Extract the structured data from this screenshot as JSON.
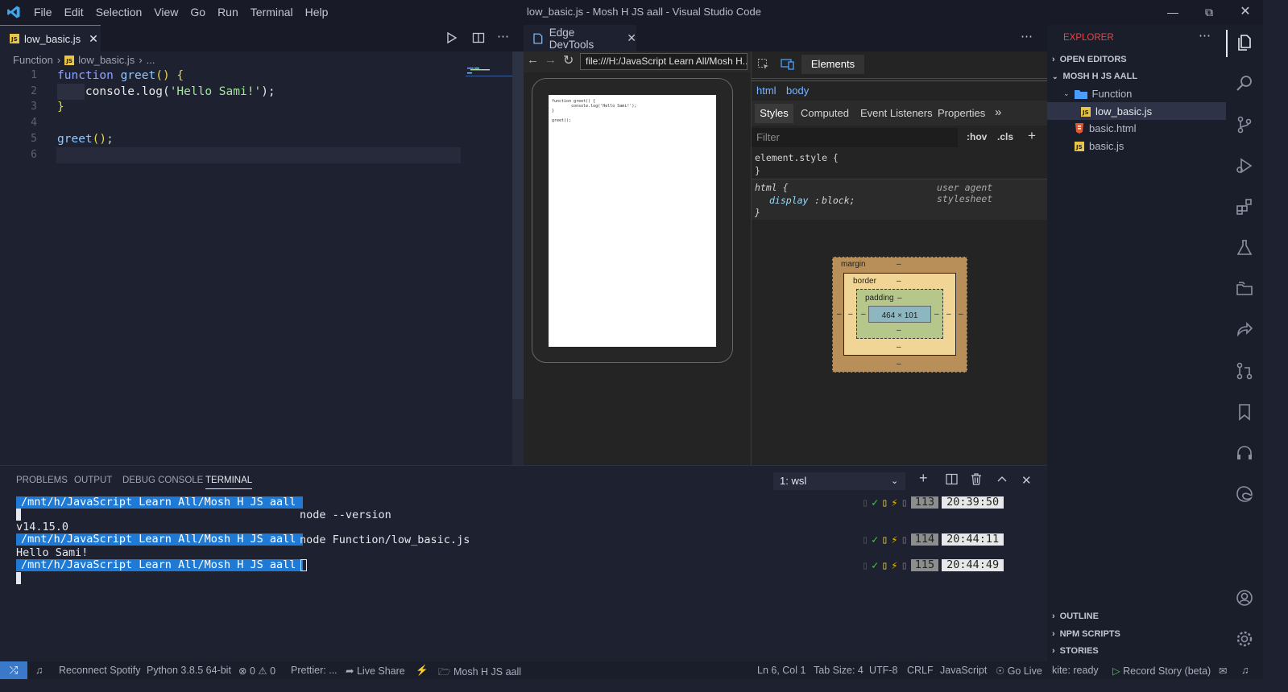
{
  "window": {
    "title": "low_basic.js - Mosh H JS aall - Visual Studio Code",
    "menu": [
      "File",
      "Edit",
      "Selection",
      "View",
      "Go",
      "Run",
      "Terminal",
      "Help"
    ]
  },
  "editor": {
    "tab_label": "low_basic.js",
    "breadcrumb": {
      "folder": "Function",
      "file": "low_basic.js",
      "more": "..."
    },
    "lines": [
      {
        "n": "1",
        "tokens": [
          {
            "t": "function",
            "c": "kw"
          },
          {
            "t": " greet",
            "c": "fn"
          },
          {
            "t": "() {",
            "c": "br"
          }
        ]
      },
      {
        "n": "2",
        "tokens": [
          {
            "t": "    console",
            "c": "id"
          },
          {
            "t": ".log(",
            "c": "id"
          },
          {
            "t": "'Hello Sami!'",
            "c": "str"
          },
          {
            "t": ");",
            "c": "id"
          }
        ]
      },
      {
        "n": "3",
        "tokens": [
          {
            "t": "}",
            "c": "br"
          }
        ]
      },
      {
        "n": "4",
        "tokens": []
      },
      {
        "n": "5",
        "tokens": [
          {
            "t": "greet",
            "c": "fn"
          },
          {
            "t": "()",
            "c": "br"
          },
          {
            "t": ";",
            "c": "pu"
          }
        ]
      },
      {
        "n": "6",
        "tokens": []
      }
    ]
  },
  "devtools": {
    "tab_label": "Edge DevTools",
    "url": "file:///H:/JavaScript Learn All/Mosh H...",
    "preview_code": "function greet() {\n        console.log('Hello Sami!');\n}\n\ngreet();",
    "panel_tab": "Elements",
    "crumbs": [
      "html",
      "body"
    ],
    "style_tabs": [
      "Styles",
      "Computed",
      "Event Listeners",
      "Properties",
      "»"
    ],
    "filter_placeholder": "Filter",
    "hov": ":hov",
    "cls": ".cls",
    "plus": "+",
    "rule1_selector": "element.style {",
    "rule1_close": "}",
    "rule2_selector": "html {",
    "rule2_source": "user agent stylesheet",
    "rule2_prop": "display",
    "rule2_value": "block;",
    "rule2_close": "}",
    "box_model": {
      "margin_label": "margin",
      "border_label": "border",
      "padding_label": "padding",
      "content": "464 × 101",
      "dash": "–"
    }
  },
  "explorer": {
    "header": "EXPLORER",
    "open_editors": "OPEN EDITORS",
    "workspace": "MOSH H JS AALL",
    "folder": "Function",
    "files": [
      "low_basic.js",
      "basic.html",
      "basic.js"
    ],
    "sections": [
      "OUTLINE",
      "NPM SCRIPTS",
      "STORIES"
    ]
  },
  "panel": {
    "tabs": [
      "PROBLEMS",
      "OUTPUT",
      "DEBUG CONSOLE",
      "TERMINAL"
    ],
    "active_tab": "TERMINAL",
    "shell": "1: wsl",
    "path": "/mnt/h/JavaScript Learn All/Mosh H JS aall ",
    "cmd1": "node --version",
    "out1": "v14.15.0",
    "cmd2": "node Function/low_basic.js",
    "out2": "Hello Sami!",
    "prompts": [
      {
        "count": "113",
        "time": "20:39:50"
      },
      {
        "count": "114",
        "time": "20:44:11"
      },
      {
        "count": "115",
        "time": "20:44:49"
      }
    ]
  },
  "statusbar": {
    "spotify": "Reconnect Spotify",
    "python": "Python 3.8.5 64-bit",
    "errors": "0",
    "warnings": "0",
    "prettier": "Prettier: ...",
    "liveshare": "Live Share",
    "folder": "Mosh H JS aall",
    "position": "Ln 6, Col 1",
    "tabsize": "Tab Size: 4",
    "encoding": "UTF-8",
    "eol": "CRLF",
    "language": "JavaScript",
    "golive": "Go Live",
    "kite": "kite: ready",
    "record": "Record Story (beta)"
  }
}
